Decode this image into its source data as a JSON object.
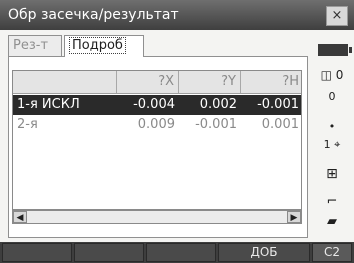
{
  "window": {
    "title": "Обр засечка/результат",
    "close_label": "×"
  },
  "tabs": [
    {
      "label": "Рез-т",
      "active": false
    },
    {
      "label": "Подроб",
      "active": true
    }
  ],
  "table": {
    "headers": [
      "",
      "?X",
      "?Y",
      "?H"
    ],
    "rows": [
      {
        "cells": [
          "1-я ИСКЛ",
          "-0.004",
          "0.002",
          "-0.001"
        ],
        "selected": true
      },
      {
        "cells": [
          "2-я",
          "0.009",
          "-0.001",
          "0.001"
        ],
        "selected": false
      }
    ]
  },
  "status_panel": {
    "mode_icon": "signal-bars-icon",
    "laser": "0",
    "prism_constant": "0",
    "tilt": "1",
    "indicators": [
      "battery-icon",
      "laser-icon",
      "tilt-icon",
      "target-icon",
      "bluetooth-icon",
      "card-icon"
    ]
  },
  "function_keys": [
    {
      "label": ""
    },
    {
      "label": ""
    },
    {
      "label": ""
    },
    {
      "label": "ДОБ"
    },
    {
      "label": "С2"
    }
  ],
  "colors": {
    "titlebar": "#4a4a4a",
    "selected_row": "#2a2a2a",
    "function_bar": "#3e3e3e"
  }
}
